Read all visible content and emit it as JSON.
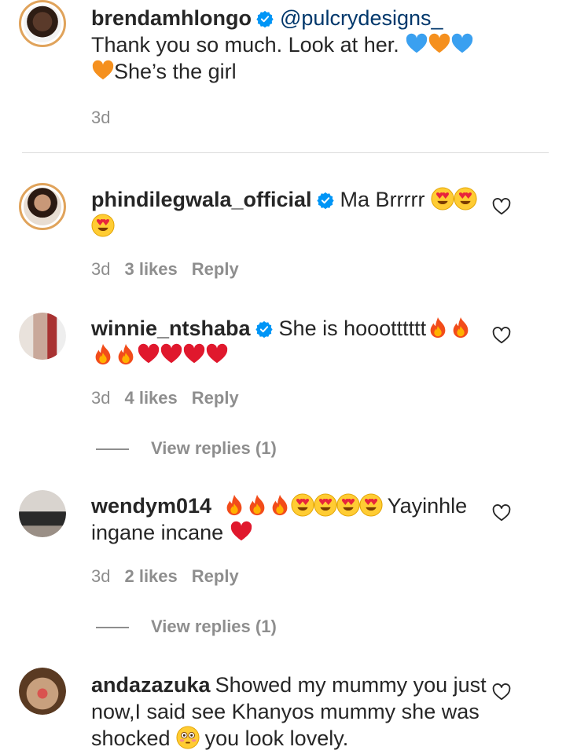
{
  "comments": [
    {
      "username": "brendamhlongo",
      "verified": true,
      "mention": "@pulcrydesigns_",
      "text_before": "Thank you so much. Look at her.",
      "text_after": "She’s the girl",
      "timestamp": "3d",
      "avatar_icon": "avatar-brendamhlongo"
    },
    {
      "username": "phindilegwala_official",
      "verified": true,
      "text": "Ma Brrrrr",
      "timestamp": "3d",
      "likes": "3 likes",
      "reply": "Reply"
    },
    {
      "username": "winnie_ntshaba",
      "verified": true,
      "text": "She is hoootttttt",
      "timestamp": "3d",
      "likes": "4 likes",
      "reply": "Reply",
      "view_replies": "View replies (1)"
    },
    {
      "username": "wendym014",
      "verified": false,
      "text_after": "Yayinhle ingane incane",
      "timestamp": "3d",
      "likes": "2 likes",
      "reply": "Reply",
      "view_replies": "View replies (1)"
    },
    {
      "username": "andazazuka",
      "verified": false,
      "text_before": "Showed my mummy you just now,I said see Khanyos mummy she was shocked",
      "text_after": "you look lovely."
    }
  ],
  "colors": {
    "text": "#262626",
    "secondary": "#8e8e8e",
    "verified": "#0095f6",
    "mention": "#00376b"
  }
}
